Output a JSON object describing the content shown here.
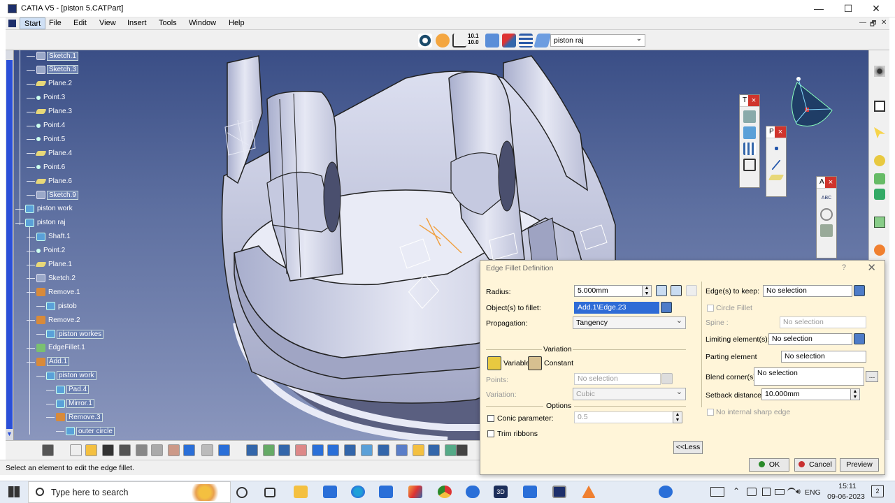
{
  "window": {
    "title": "CATIA V5 - [piston  5.CATPart]",
    "min": "—",
    "max": "☐",
    "close": "✕"
  },
  "menu": [
    "Start",
    "File",
    "Edit",
    "View",
    "Insert",
    "Tools",
    "Window",
    "Help"
  ],
  "mdi": {
    "min": "—",
    "restore": "🗗",
    "close": "✕"
  },
  "toolbar": {
    "part_select": "piston raj",
    "num_icon_top": "10.1",
    "num_icon_bot": "10.0"
  },
  "tree": [
    {
      "label": "Sketch.1",
      "icon": "sketch-icon",
      "highlight": true
    },
    {
      "label": "Sketch.3",
      "icon": "sketch-icon",
      "highlight": true
    },
    {
      "label": "Plane.2",
      "icon": "plane-icon",
      "highlight": false
    },
    {
      "label": "Point.3",
      "icon": "point-icon",
      "highlight": false
    },
    {
      "label": "Plane.3",
      "icon": "plane-icon",
      "highlight": false
    },
    {
      "label": "Point.4",
      "icon": "point-icon",
      "highlight": false
    },
    {
      "label": "Point.5",
      "icon": "point-icon",
      "highlight": false
    },
    {
      "label": "Plane.4",
      "icon": "plane-icon",
      "highlight": false
    },
    {
      "label": "Point.6",
      "icon": "point-icon",
      "highlight": false
    },
    {
      "label": "Plane.6",
      "icon": "plane-icon",
      "highlight": false
    },
    {
      "label": "Sketch.9",
      "icon": "sketch-icon",
      "highlight": true
    },
    {
      "label": "piston work",
      "icon": "body-icon",
      "highlight": false
    },
    {
      "label": "piston raj",
      "icon": "body-icon",
      "highlight": false
    },
    {
      "label": "Shaft.1",
      "icon": "shaft-icon",
      "highlight": false
    },
    {
      "label": "Point.2",
      "icon": "point-icon",
      "highlight": false
    },
    {
      "label": "Plane.1",
      "icon": "plane-icon",
      "highlight": false
    },
    {
      "label": "Sketch.2",
      "icon": "sketch-icon",
      "highlight": false
    },
    {
      "label": "Remove.1",
      "icon": "remove-icon",
      "highlight": false
    },
    {
      "label": "pistob",
      "icon": "body-icon",
      "highlight": false
    },
    {
      "label": "Remove.2",
      "icon": "remove-icon",
      "highlight": false
    },
    {
      "label": "piston workes",
      "icon": "body-icon",
      "highlight": true
    },
    {
      "label": "EdgeFillet.1",
      "icon": "fillet-icon",
      "highlight": false
    },
    {
      "label": "Add.1",
      "icon": "add-icon",
      "highlight": true
    },
    {
      "label": "piston work",
      "icon": "body-icon",
      "highlight": true
    },
    {
      "label": "Pad.4",
      "icon": "pad-icon",
      "highlight": true
    },
    {
      "label": "Mirror.1",
      "icon": "mirror-icon",
      "highlight": true
    },
    {
      "label": "Remove.3",
      "icon": "remove-icon",
      "highlight": true
    },
    {
      "label": "outer circle",
      "icon": "body-icon",
      "highlight": true
    }
  ],
  "floating": {
    "t_title": "T",
    "p_title": "P",
    "a_title": "A",
    "close": "×",
    "abc": "ABC"
  },
  "status": "Select an element to edit the edge fillet.",
  "dialog": {
    "title": "Edge Fillet Definition",
    "help": "?",
    "close": "✕",
    "radius_label": "Radius:",
    "radius_value": "5.000mm",
    "objects_label": "Object(s) to fillet:",
    "objects_value": "Add.1\\Edge.23",
    "propagation_label": "Propagation:",
    "propagation_value": "Tangency",
    "variation_header": "Variation",
    "variable_label": "Variable",
    "constant_label": "Constant",
    "points_label": "Points:",
    "points_value": "No selection",
    "variation_label": "Variation:",
    "variation_value": "Cubic",
    "options_header": "Options",
    "conic_label": "Conic parameter:",
    "conic_value": "0.5",
    "trim_label": "Trim ribbons",
    "less_button": "<<Less",
    "edges_keep_label": "Edge(s) to keep:",
    "edges_keep_value": "No selection",
    "circle_fillet_label": "Circle Fillet",
    "spine_label": "Spine :",
    "spine_value": "No selection",
    "limiting_label": "Limiting element(s):",
    "limiting_value": "No selection",
    "parting_label": "Parting element",
    "parting_value": "No selection",
    "blend_label": "Blend corner(s)",
    "blend_value": "No selection",
    "blend_btn": "...",
    "setback_label": "Setback distance:",
    "setback_value": "10.000mm",
    "no_sharp_label": "No internal sharp edge",
    "ok": "OK",
    "cancel": "Cancel",
    "preview": "Preview"
  },
  "taskbar": {
    "search": "Type here to search",
    "lang": "ENG",
    "time": "15:11",
    "date": "09-06-2023",
    "notif": "2",
    "app_3d": "3D"
  }
}
